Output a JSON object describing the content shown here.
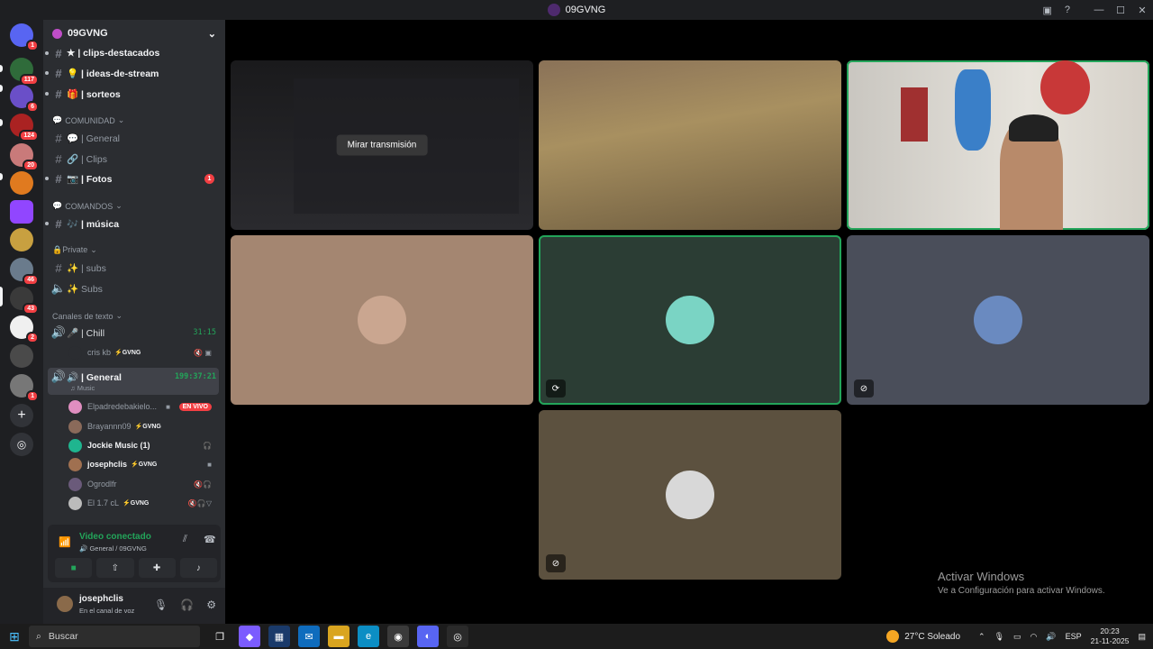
{
  "window": {
    "title": "09GVNG"
  },
  "servers": [
    {
      "name": "discord-home",
      "badge": "1",
      "color": "#5865f2"
    },
    {
      "name": "server-1",
      "badge": "117",
      "color": "#2f6b3a"
    },
    {
      "name": "server-2",
      "badge": "6",
      "color": "#6a4fc8"
    },
    {
      "name": "server-3",
      "badge": "124",
      "color": "#aa2222"
    },
    {
      "name": "server-4",
      "badge": "20",
      "color": "#c97a7a"
    },
    {
      "name": "server-5",
      "badge": "",
      "color": "#e07a1f"
    },
    {
      "name": "twitch",
      "badge": "",
      "color": "#9146ff"
    },
    {
      "name": "server-7",
      "badge": "",
      "color": "#c8a040"
    },
    {
      "name": "server-8",
      "badge": "46",
      "color": "#6a7b8c"
    },
    {
      "name": "server-9",
      "badge": "43",
      "color": "#3a3a3a"
    },
    {
      "name": "server-10",
      "badge": "2",
      "color": "#f0f0f0"
    },
    {
      "name": "server-11",
      "badge": "",
      "color": "#4a4a4a"
    },
    {
      "name": "server-12",
      "badge": "1",
      "color": "#777777"
    }
  ],
  "server_header": {
    "name": "09GVNG"
  },
  "channels": {
    "clips": "★ | clips-destacados",
    "ideas": "💡 | ideas-de-stream",
    "sorteos": "🎁 | sorteos",
    "cat_comunidad": "COMUNIDAD",
    "general": "💬 | General",
    "clips2": "🔗 | Clips",
    "fotos": "📷 | Fotos",
    "fotos_badge": "1",
    "cat_comandos": "COMANDOS",
    "musica": "🎶 | música",
    "cat_private": "🔒Private",
    "subs": "✨ | subs",
    "subs_voice": "✨ Subs",
    "cat_texto": "Canales de texto",
    "chill": "🎤 | Chill",
    "chill_timer": "31:15",
    "general_voice": "🔊 | General",
    "general_timer": "199:37:21",
    "general_activity": "♫ Music"
  },
  "voice_users": [
    {
      "name": "cris kb",
      "tag": "⚡GVNG",
      "icons": "🔇 ▣"
    },
    {
      "name": "Elpadredebakielo...",
      "tag": "",
      "live": "EN VIVO"
    },
    {
      "name": "Brayannn09",
      "tag": "⚡GVNG"
    },
    {
      "name": "Jockie Music (1)",
      "tag": ""
    },
    {
      "name": "josephclis",
      "tag": "⚡GVNG"
    },
    {
      "name": "Ogrodlfr",
      "tag": ""
    },
    {
      "name": "El 1.7 cL",
      "tag": "⚡GVNG"
    }
  ],
  "voice_panel": {
    "status": "Video conectado",
    "location": "General / 09GVNG"
  },
  "user_panel": {
    "username": "josephclis",
    "status": "En el canal de voz"
  },
  "stage": {
    "watch_label": "Mirar transmisión",
    "activate_title": "Activar Windows",
    "activate_sub": "Ve a Configuración para activar Windows."
  },
  "taskbar": {
    "search_placeholder": "Buscar",
    "weather": "27°C  Soleado",
    "lang": "ESP",
    "time": "20:23",
    "date": "21-11-2025"
  }
}
